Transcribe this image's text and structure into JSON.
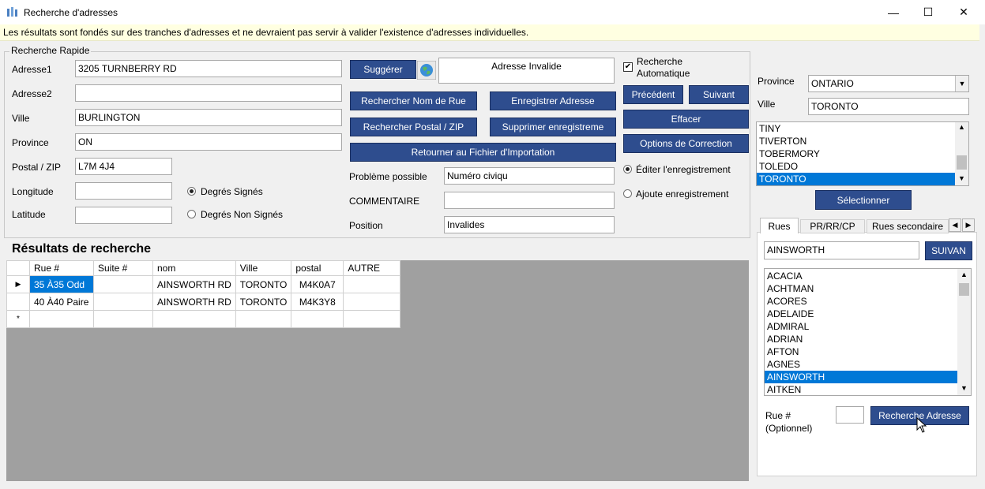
{
  "window": {
    "title": "Recherche d'adresses",
    "minimize": "—",
    "maximize": "☐",
    "close": "✕"
  },
  "notice": "Les résultats sont fondés sur des tranches d'adresses et ne devraient pas servir à valider l'existence d'adresses individuelles.",
  "quick_search": {
    "legend": "Recherche Rapide",
    "adresse1_label": "Adresse1",
    "adresse1_value": "3205 TURNBERRY RD",
    "adresse2_label": "Adresse2",
    "adresse2_value": "",
    "ville_label": "Ville",
    "ville_value": "BURLINGTON",
    "province_label": "Province",
    "province_value": "ON",
    "postal_label": "Postal / ZIP",
    "postal_value": "L7M 4J4",
    "longitude_label": "Longitude",
    "longitude_value": "",
    "latitude_label": "Latitude",
    "latitude_value": "",
    "radio_signed": "Degrés Signés",
    "radio_unsigned": "Degrés Non Signés",
    "btn_suggest": "Suggérer",
    "address_status": "Adresse Invalide",
    "btn_search_street": "Rechercher Nom de Rue",
    "btn_save_address": "Enregistrer Adresse",
    "btn_search_postal": "Rechercher Postal / ZIP",
    "btn_delete_record": "Supprimer enregistreme",
    "btn_return_import": "Retourner au Fichier d'Importation",
    "problem_label": "Problème possible",
    "problem_value": "Numéro civiqu",
    "comment_label": "COMMENTAIRE",
    "comment_value": "",
    "position_label": "Position",
    "position_value": "Invalides",
    "auto_search_label": "Recherche Automatique",
    "auto_search_checked": "✔",
    "btn_previous": "Précédent",
    "btn_next": "Suivant",
    "btn_clear": "Effacer",
    "btn_options": "Options de Correction",
    "radio_edit": "Éditer l'enregistrement",
    "radio_add": "Ajoute enregistrement"
  },
  "results": {
    "title": "Résultats de recherche",
    "columns": [
      "Rue #",
      "Suite #",
      "nom",
      "Ville",
      "postal",
      "AUTRE"
    ],
    "rows": [
      {
        "marker": "▶",
        "cells": [
          "35 À35 Odd",
          "",
          "AINSWORTH RD",
          "TORONTO",
          "M4K0A7",
          ""
        ]
      },
      {
        "marker": "",
        "cells": [
          "40 À40 Paire",
          "",
          "AINSWORTH RD",
          "TORONTO",
          "M4K3Y8",
          ""
        ]
      }
    ],
    "new_row_marker": "*"
  },
  "right_panel": {
    "province_label": "Province",
    "province_value": "ONTARIO",
    "ville_label": "Ville",
    "ville_value": "TORONTO",
    "cities": [
      "TINY",
      "TIVERTON",
      "TOBERMORY",
      "TOLEDO",
      "TORONTO"
    ],
    "selected_city": "TORONTO",
    "btn_select": "Sélectionner",
    "tabs": [
      "Rues",
      "PR/RR/CP",
      "Rues secondaire"
    ],
    "street_search_value": "AINSWORTH",
    "btn_next_street": "SUIVAN",
    "streets": [
      "ACACIA",
      "ACHTMAN",
      "ACORES",
      "ADELAIDE",
      "ADMIRAL",
      "ADRIAN",
      "AFTON",
      "AGNES",
      "AINSWORTH",
      "AITKEN"
    ],
    "selected_street": "AINSWORTH",
    "rue_label_1": "Rue #",
    "rue_label_2": "(Optionnel)",
    "rue_value": "",
    "btn_search_address": "Recherche Adresse"
  },
  "colors": {
    "button_bg": "#2e4d8e",
    "selection": "#0078d7",
    "notice_bg": "#ffffe1"
  }
}
